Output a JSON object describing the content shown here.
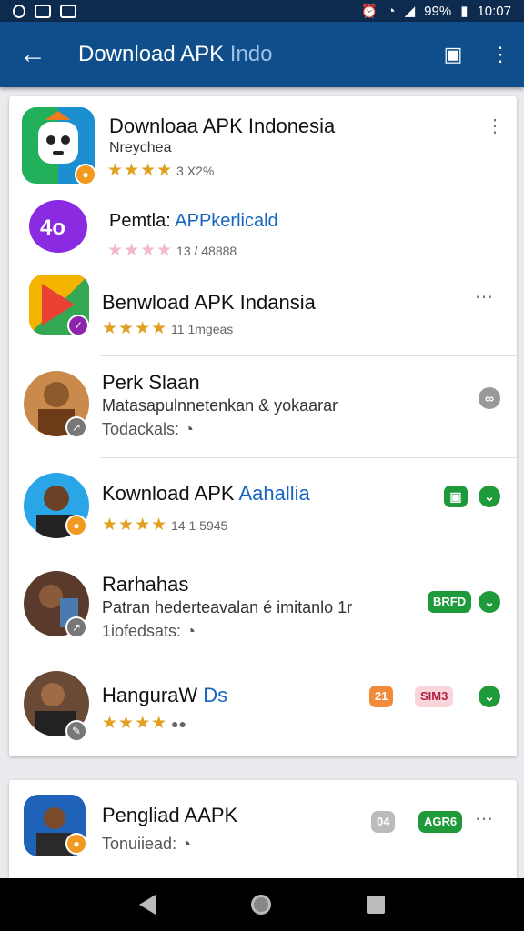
{
  "status": {
    "battery": "99%",
    "time": "10:07"
  },
  "header": {
    "title_main": "Download APK",
    "title_dim": " Indo"
  },
  "rows": [
    {
      "name": "Downloaa APK Indonesia",
      "sub": "Nreychea",
      "rating": "★★★★",
      "meta": "3  X2%",
      "stars_color": "#e0a020"
    },
    {
      "name": "Pemtla: ",
      "name_blue": "APPkerlicald",
      "meta": "13 / 48888",
      "rating": "★★★★"
    },
    {
      "name": "Benwload APK Indansia",
      "rating": "★★★★",
      "meta": "11 1mgeas"
    },
    {
      "name": "Perk Slaan",
      "sub": "Matasapulnnetenkan & yokaarar",
      "meta": "Todackals:"
    },
    {
      "name": "Kownload APK ",
      "name_blue": "Aahallia",
      "rating": "★★★★",
      "meta": "14  1 5945"
    },
    {
      "name": "Rarhahas",
      "sub": "Patran hederteavalan é imitanlo 1r",
      "meta": "1iofedsats:",
      "pill": "BRFD"
    },
    {
      "name": "HanguraW",
      "name_blue": " Ds",
      "rating": "★★★★",
      "pill_orange": "21",
      "pill_pink": "SIM3"
    },
    {
      "name": "Pengliad AAPK",
      "meta": "Tonuiiead:",
      "pill_grey": "04",
      "pill": "AGR6"
    }
  ]
}
